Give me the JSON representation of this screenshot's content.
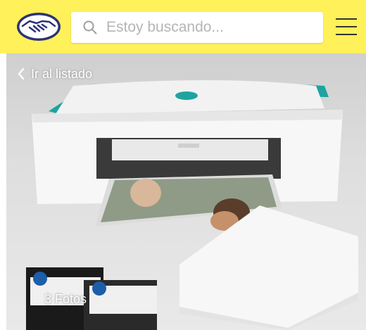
{
  "header": {
    "logo_icon": "handshake-logo-icon",
    "search": {
      "placeholder": "Estoy buscando...",
      "icon": "search-icon"
    },
    "menu_icon": "hamburger-menu-icon",
    "background_color": "#fff159"
  },
  "gallery": {
    "back_label": "Ir al listado",
    "back_icon": "chevron-left-icon",
    "photo_count_label": "3 Fotos",
    "accent_color": "#1fa3a0",
    "product_image": "hp-printer-photo"
  }
}
